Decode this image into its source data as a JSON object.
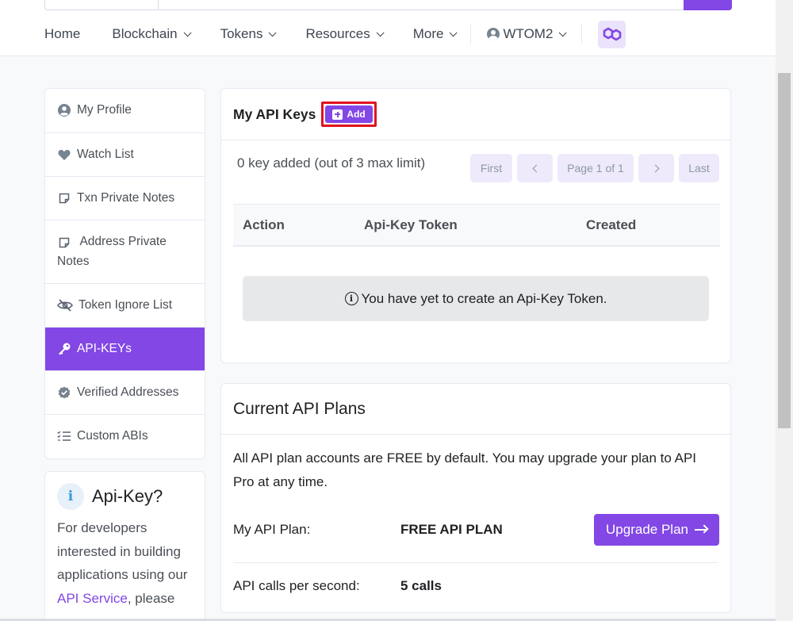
{
  "nav": {
    "home": "Home",
    "blockchain": "Blockchain",
    "tokens": "Tokens",
    "resources": "Resources",
    "more": "More",
    "user": "WTOM2"
  },
  "sidebar": {
    "items": [
      {
        "label": "My Profile",
        "icon": "user-circle-icon"
      },
      {
        "label": "Watch List",
        "icon": "heart-icon"
      },
      {
        "label": "Txn Private Notes",
        "icon": "sticky-note-icon"
      },
      {
        "label": "Address Private Notes",
        "icon": "sticky-note-icon"
      },
      {
        "label": "Token Ignore List",
        "icon": "eye-slash-icon"
      },
      {
        "label": "API-KEYs",
        "icon": "key-icon"
      },
      {
        "label": "Verified Addresses",
        "icon": "verified-badge-icon"
      },
      {
        "label": "Custom ABIs",
        "icon": "tasks-list-icon"
      }
    ]
  },
  "apikey_card": {
    "title": "Api-Key?",
    "text_before": "For developers interested in building applications using our ",
    "link": "API Service",
    "text_after": ", please"
  },
  "keys_card": {
    "title": "My API Keys",
    "add_label": "Add",
    "count_text": "0 key added (out of 3 max limit)",
    "pager": {
      "first": "First",
      "page": "Page 1 of 1",
      "last": "Last"
    },
    "columns": [
      "Action",
      "Api-Key Token",
      "Created"
    ],
    "empty_message": "You have yet to create an Api-Key Token."
  },
  "plans_card": {
    "title": "Current API Plans",
    "description": "All API plan accounts are FREE by default. You may upgrade your plan to API Pro at any time.",
    "plan_label": "My API Plan:",
    "plan_value": "FREE API PLAN",
    "upgrade_label": "Upgrade Plan",
    "calls_label": "API calls per second:",
    "calls_value": "5 calls"
  },
  "colors": {
    "accent": "#8247e5",
    "highlight_border": "#e1101e"
  }
}
